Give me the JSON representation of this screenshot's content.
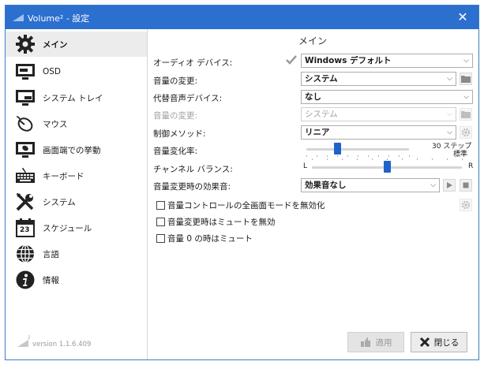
{
  "window": {
    "title": "Volume² - 設定",
    "close_glyph": "✕"
  },
  "sidebar": {
    "items": [
      {
        "label": "メイン",
        "icon": "gear-icon"
      },
      {
        "label": "OSD",
        "icon": "monitor-icon"
      },
      {
        "label": "システム トレイ",
        "icon": "tray-icon"
      },
      {
        "label": "マウス",
        "icon": "mouse-icon"
      },
      {
        "label": "画面端での挙動",
        "icon": "screen-edge-icon"
      },
      {
        "label": "キーボード",
        "icon": "keyboard-icon"
      },
      {
        "label": "システム",
        "icon": "tools-icon"
      },
      {
        "label": "スケジュール",
        "icon": "calendar-icon",
        "calendar_day": "23"
      },
      {
        "label": "言語",
        "icon": "globe-icon"
      },
      {
        "label": "情報",
        "icon": "info-icon"
      }
    ],
    "version": "version 1.1.6.409"
  },
  "main": {
    "title": "メイン",
    "audio_device": {
      "label": "オーディオ デバイス:",
      "value": "Windows デフォルト"
    },
    "volume_change": {
      "label": "音量の変更:",
      "value": "システム"
    },
    "alt_device": {
      "label": "代替音声デバイス:",
      "value": "なし"
    },
    "alt_volume_change": {
      "label": "音量の変更:",
      "value": "システム"
    },
    "control_method": {
      "label": "制御メソッド:",
      "value": "リニア"
    },
    "volume_rate": {
      "label": "音量変化率:",
      "value_text": "30 ステップ",
      "sub_text": "標準",
      "level": 0.3
    },
    "channel_balance": {
      "label": "チャンネル バランス:",
      "left": "L",
      "right": "R",
      "level": 0.5
    },
    "sound_effect": {
      "label": "音量変更時の効果音:",
      "value": "効果音なし"
    },
    "checkboxes": [
      {
        "label": "音量コントロールの全画面モードを無効化",
        "checked": false
      },
      {
        "label": "音量変更時はミュートを無効",
        "checked": false
      },
      {
        "label": "音量 0 の時はミュート",
        "checked": false
      }
    ]
  },
  "footer": {
    "apply_label": "適用",
    "close_label": "閉じる"
  }
}
